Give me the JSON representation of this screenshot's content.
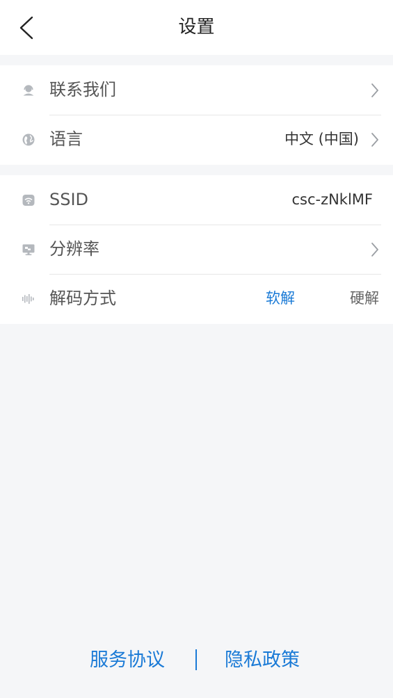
{
  "header": {
    "title": "设置",
    "back_icon": "chevron-left-icon"
  },
  "groups": [
    {
      "rows": [
        {
          "icon": "headset-icon",
          "label": "联系我们",
          "value": "",
          "chevron": true
        },
        {
          "icon": "globe-icon",
          "label": "语言",
          "value": "中文 (中国)",
          "chevron": true
        }
      ]
    },
    {
      "rows": [
        {
          "icon": "wifi-icon",
          "label": "SSID",
          "value": "csc-zNklMF",
          "chevron": false
        },
        {
          "icon": "monitor-icon",
          "label": "分辨率",
          "value": "",
          "chevron": true
        },
        {
          "icon": "waveform-icon",
          "label": "解码方式",
          "options": [
            "软解",
            "硬解"
          ],
          "selected": "软解"
        }
      ]
    }
  ],
  "footer": {
    "service_agreement": "服务协议",
    "privacy_policy": "隐私政策"
  },
  "colors": {
    "accent": "#1a7ad6",
    "background": "#f5f6f8",
    "card": "#ffffff",
    "icon": "#b4b8bd"
  }
}
